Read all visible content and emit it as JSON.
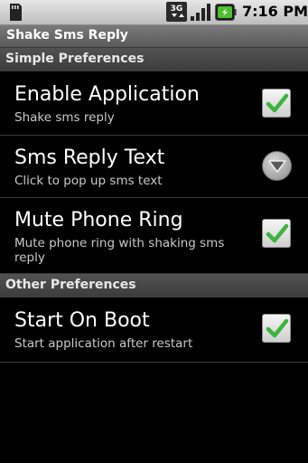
{
  "status_bar": {
    "time": "7:16 PM",
    "network": "3G"
  },
  "title_bar": {
    "title": "Shake Sms Reply"
  },
  "sections": [
    {
      "header": "Simple Preferences"
    },
    {
      "header": "Other Preferences"
    }
  ],
  "preferences": [
    {
      "title": "Enable Application",
      "summary": "Shake sms reply",
      "widget": "checkbox",
      "checked": true
    },
    {
      "title": "Sms Reply Text",
      "summary": "Click to pop up sms text",
      "widget": "dropdown"
    },
    {
      "title": "Mute Phone Ring",
      "summary": "Mute phone ring with shaking sms reply",
      "widget": "checkbox",
      "checked": true
    },
    {
      "title": "Start On Boot",
      "summary": "Start application after restart",
      "widget": "checkbox",
      "checked": true
    }
  ],
  "colors": {
    "check": "#3cb43c",
    "status_bar": "#d6d6d6",
    "section_header": "#4a4a4a"
  },
  "icons": {
    "sd_card": "sd-card-icon",
    "network": "3g-icon",
    "signal": "signal-icon",
    "battery": "battery-charging-icon",
    "check": "check-icon",
    "dropdown": "chevron-down-icon"
  }
}
